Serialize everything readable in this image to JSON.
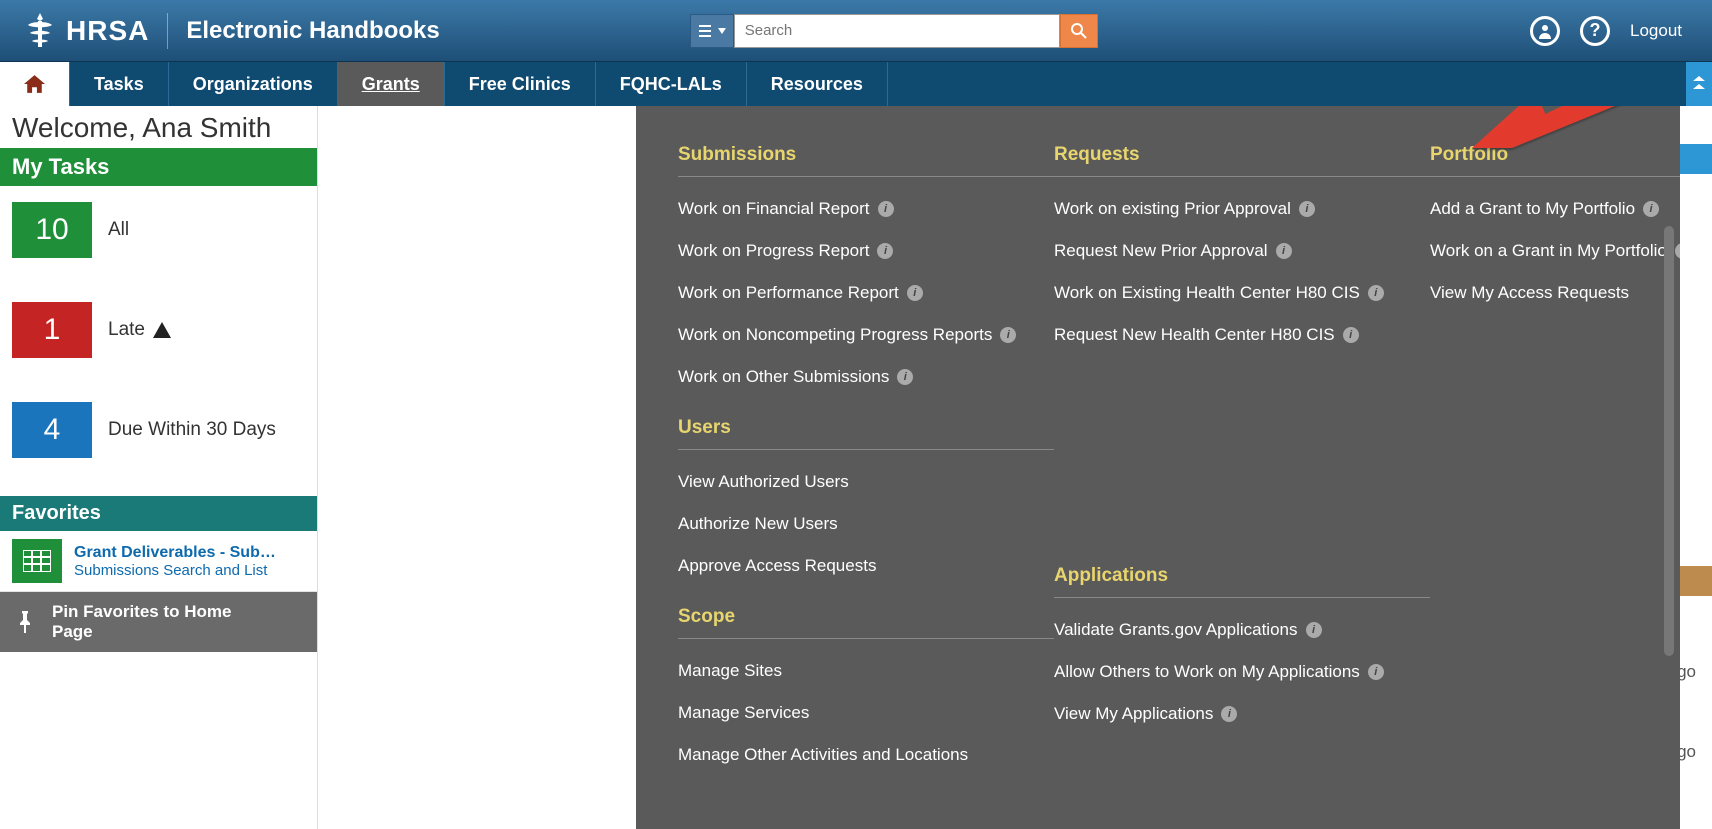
{
  "header": {
    "logo_text": "HRSA",
    "app_title": "Electronic Handbooks",
    "search_placeholder": "Search",
    "logout": "Logout"
  },
  "nav": {
    "tasks": "Tasks",
    "organizations": "Organizations",
    "grants": "Grants",
    "free_clinics": "Free Clinics",
    "fqhc": "FQHC-LALs",
    "resources": "Resources"
  },
  "welcome": "Welcome, Ana Smith",
  "mytasks_header": "My Tasks",
  "tasks": {
    "all_count": "10",
    "all_label": "All",
    "late_count": "1",
    "late_label": "Late",
    "due_count": "4",
    "due_label": "Due Within 30 Days"
  },
  "favorites_header": "Favorites",
  "fav": {
    "title": "Grant Deliverables - Sub…",
    "sub": "Submissions Search and List"
  },
  "pin_label": "Pin Favorites to Home Page",
  "ago_text": "ago",
  "mega": {
    "submissions_title": "Submissions",
    "submissions": [
      "Work on Financial Report",
      "Work on Progress Report",
      "Work on Performance Report",
      "Work on Noncompeting Progress Reports",
      "Work on Other Submissions"
    ],
    "users_title": "Users",
    "users": [
      "View Authorized Users",
      "Authorize New Users",
      "Approve Access Requests"
    ],
    "scope_title": "Scope",
    "scope": [
      "Manage Sites",
      "Manage Services",
      "Manage Other Activities and Locations"
    ],
    "requests_title": "Requests",
    "requests": [
      "Work on existing Prior Approval",
      "Request New Prior Approval",
      "Work on Existing Health Center H80 CIS",
      "Request New Health Center H80 CIS"
    ],
    "applications_title": "Applications",
    "applications": [
      "Validate Grants.gov Applications",
      "Allow Others to Work on My Applications",
      "View My Applications"
    ],
    "portfolio_title": "Portfolio",
    "portfolio": [
      "Add a Grant to My Portfolio",
      "Work on a Grant in My Portfolio",
      "View My Access Requests"
    ]
  }
}
